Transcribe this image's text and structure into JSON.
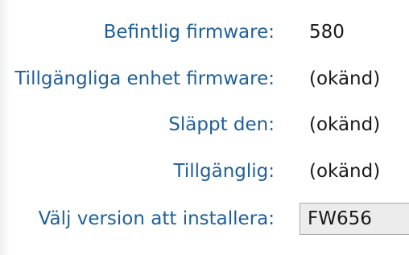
{
  "firmware_info": {
    "current_label": "Befintlig firmware:",
    "current_value": "580",
    "available_label": "Tillgängliga enhet firmware:",
    "available_value": "(okänd)",
    "released_label": "Släppt den:",
    "released_value": "(okänd)",
    "availability_label": "Tillgänglig:",
    "availability_value": "(okänd)",
    "install_label": "Välj version att installera:",
    "install_selected": "FW656"
  }
}
